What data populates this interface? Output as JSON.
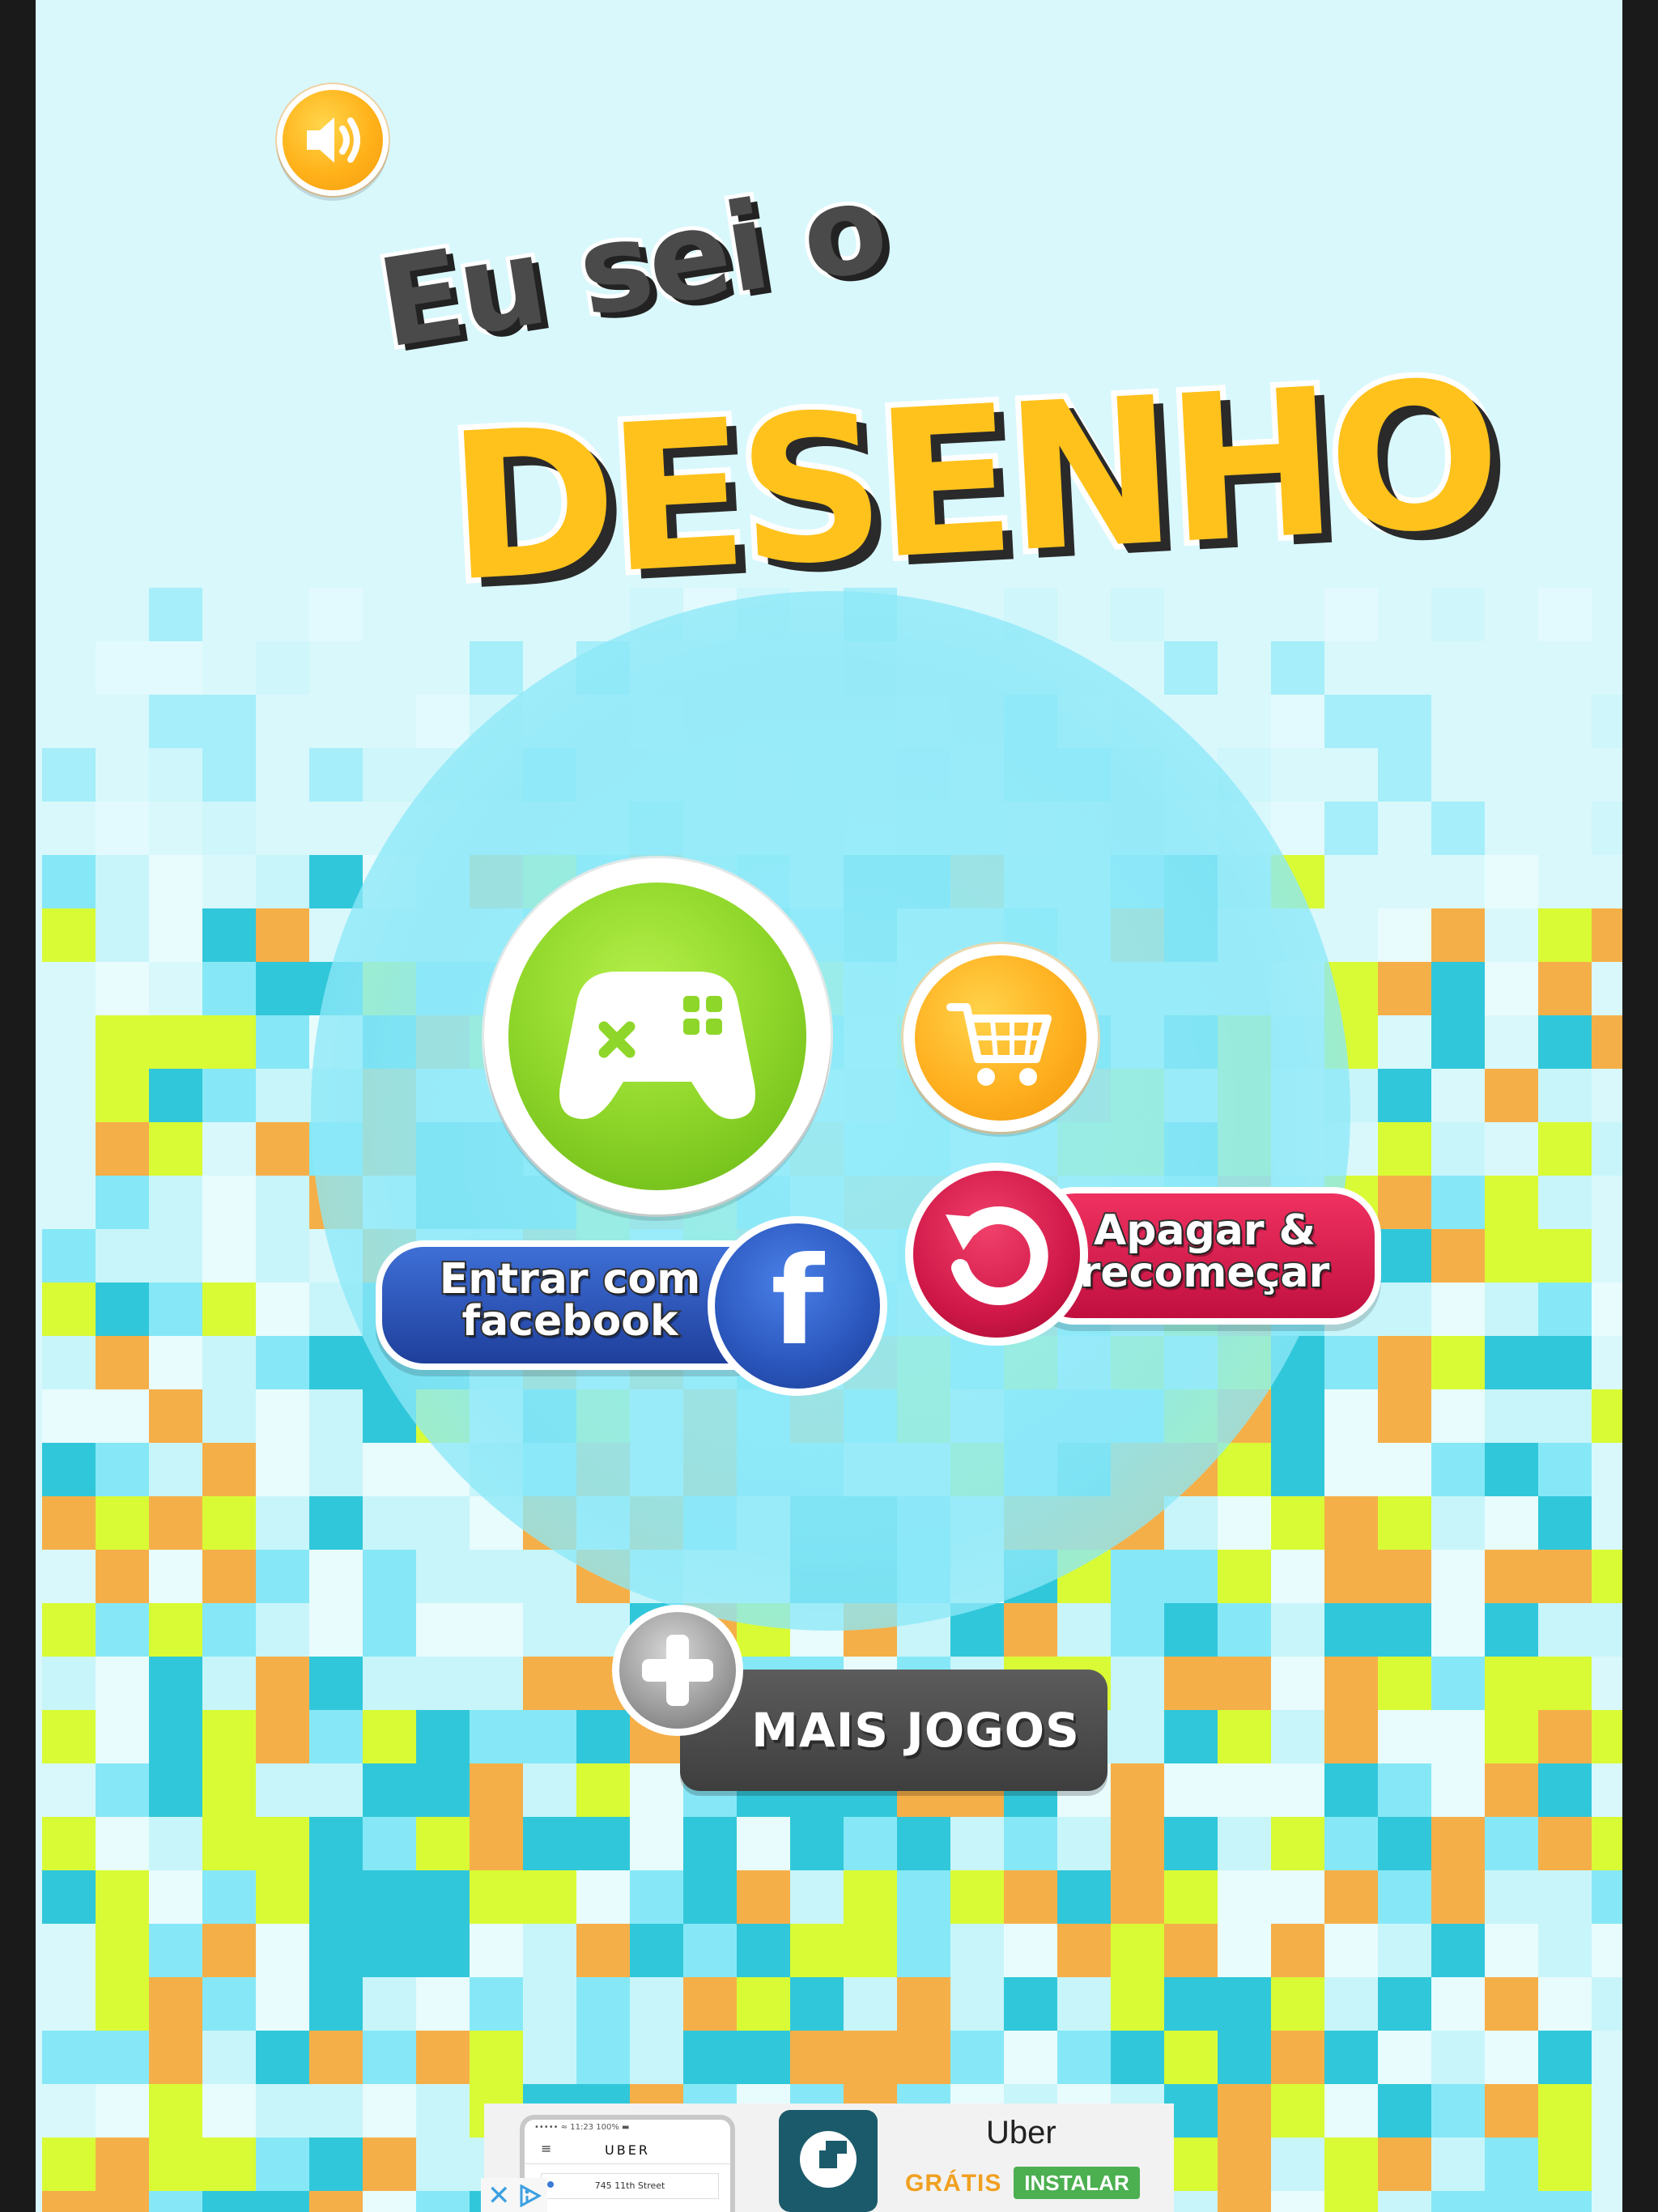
{
  "game": {
    "title_line1": "Eu sei o",
    "title_line2": "DESENHO"
  },
  "buttons": {
    "sound_icon": "speaker-volume-icon",
    "play_icon": "gamepad-icon",
    "cart_icon": "shopping-cart-icon",
    "facebook_label": "Entrar com facebook",
    "facebook_icon": "f",
    "reset_label": "Apagar & recomeçar",
    "reset_icon": "undo-arrow-icon",
    "more_games_label": "MAIS JOGOS",
    "more_games_icon": "plus-icon"
  },
  "ad": {
    "app_name": "Uber",
    "price": "GRÁTIS",
    "install_label": "INSTALAR",
    "preview_status": "••••• ≈   11:23   100% ▬",
    "preview_brand": "UBER",
    "preview_address": "745 11th Street",
    "close_glyph": "✕"
  },
  "colors": {
    "background": "#d9f8fc",
    "title_yellow": "#ffc21c",
    "play_green": "#8fd62a",
    "cart_orange": "#ffb020",
    "facebook_blue": "#2a56bc",
    "reset_red": "#d01848",
    "more_gray": "#4a4a4a",
    "mosaic": [
      "#f7a635",
      "#d8fb1f",
      "#1ec1d6",
      "#7ce6f5",
      "#c5f4fa",
      "#e9fbfd"
    ]
  }
}
